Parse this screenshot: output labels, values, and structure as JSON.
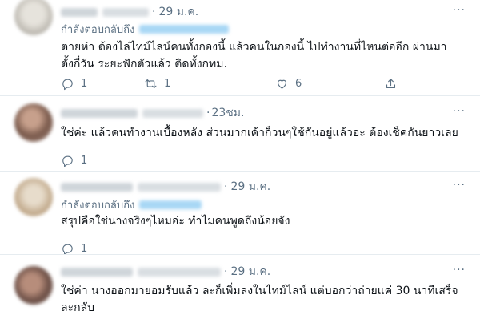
{
  "tweets": [
    {
      "time": "29 ม.ค.",
      "reply_label": "กำลังตอบกลับถึง",
      "text_lines": [
        "ตายห่า ต้องไล่ไทม์ไลน์คนทั้งกองนี้ แล้วคนในกองนี้ ไปทำงานที่ไหนต่ออีก ผ่านมา",
        "ตั้งกี่วัน ระยะฟักตัวแล้ว ติดทั้งกทม."
      ],
      "reply_count": "1",
      "retweet_count": "1",
      "like_count": "6"
    },
    {
      "time": "23ชม.",
      "text_lines": [
        "ใช่ค่ะ แล้วคนทำงานเบื้องหลัง ส่วนมากเค้าก็วนๆใช้กันอยู่แล้วอะ ต้องเช็คกันยาวเลย"
      ],
      "reply_count": "1",
      "retweet_count": "",
      "like_count": ""
    },
    {
      "time": "29 ม.ค.",
      "reply_label": "กำลังตอบกลับถึง",
      "text_lines": [
        "สรุปคือใช่นางจริงๆไหมอ่ะ ทำไมคนพูดถึงน้อยจัง"
      ],
      "reply_count": "1",
      "retweet_count": "",
      "like_count": ""
    },
    {
      "time": "29 ม.ค.",
      "text_lines": [
        "ใช่ค่า นางออกมายอมรับแล้ว ละก็เพิ่มลงในไทม์ไลน์ แต่บอกว่าถ่ายแค่ 30 นาทีเสร็จ",
        "ละกลับ"
      ]
    }
  ],
  "more_glyph": "···",
  "dot": "·",
  "icons": [
    "reply-icon",
    "retweet-icon",
    "like-icon",
    "share-icon",
    "more-icon"
  ]
}
